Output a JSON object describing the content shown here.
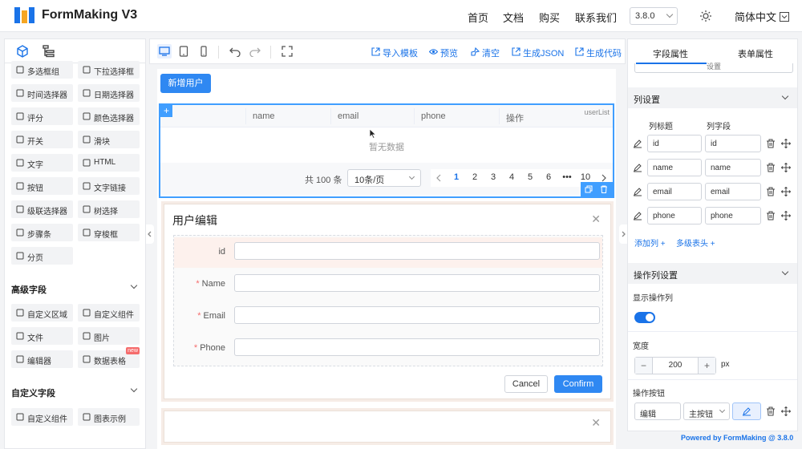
{
  "header": {
    "brand": "FormMaking V3",
    "nav": [
      "首页",
      "文档",
      "购买",
      "联系我们"
    ],
    "version": "3.8.0",
    "language": "简体中文"
  },
  "left_panel": {
    "basic_items": [
      {
        "label": "多选框组",
        "icon": "checkbox-icon"
      },
      {
        "label": "下拉选择框",
        "icon": "select-icon"
      },
      {
        "label": "时间选择器",
        "icon": "clock-icon"
      },
      {
        "label": "日期选择器",
        "icon": "calendar-icon"
      },
      {
        "label": "评分",
        "icon": "star-icon"
      },
      {
        "label": "颜色选择器",
        "icon": "palette-icon"
      },
      {
        "label": "开关",
        "icon": "switch-icon"
      },
      {
        "label": "滑块",
        "icon": "slider-icon"
      },
      {
        "label": "文字",
        "icon": "text-icon"
      },
      {
        "label": "HTML",
        "icon": "html-icon"
      },
      {
        "label": "按钮",
        "icon": "button-icon"
      },
      {
        "label": "文字链接",
        "icon": "link-icon"
      },
      {
        "label": "级联选择器",
        "icon": "cascader-icon"
      },
      {
        "label": "树选择",
        "icon": "tree-icon"
      },
      {
        "label": "步骤条",
        "icon": "steps-icon"
      },
      {
        "label": "穿梭框",
        "icon": "transfer-icon"
      },
      {
        "label": "分页",
        "icon": "pagination-icon"
      }
    ],
    "advanced_title": "高级字段",
    "advanced_items": [
      {
        "label": "自定义区域",
        "icon": "custom-area-icon"
      },
      {
        "label": "自定义组件",
        "icon": "custom-component-icon"
      },
      {
        "label": "文件",
        "icon": "file-icon"
      },
      {
        "label": "图片",
        "icon": "image-icon"
      },
      {
        "label": "编辑器",
        "icon": "editor-icon"
      },
      {
        "label": "数据表格",
        "icon": "table-icon"
      }
    ],
    "new_badge": "new",
    "custom_title": "自定义字段",
    "custom_items": [
      {
        "label": "自定义组件",
        "icon": "custom-component-icon"
      },
      {
        "label": "图表示例",
        "icon": "chart-icon"
      }
    ]
  },
  "toolbar": {
    "actions": [
      "导入模板",
      "预览",
      "清空",
      "生成JSON",
      "生成代码"
    ]
  },
  "canvas": {
    "add_user_button": "新增用户",
    "table": {
      "columns": [
        "name",
        "email",
        "phone",
        "操作"
      ],
      "label": "userList",
      "empty_text": "暂无数据",
      "total": "共 100 条",
      "page_size": "10条/页",
      "pages": [
        "1",
        "2",
        "3",
        "4",
        "5",
        "6",
        "•••",
        "10"
      ]
    },
    "dialog": {
      "title": "用户编辑",
      "fields": [
        {
          "label": "id",
          "required": ""
        },
        {
          "label": "Name",
          "required": "*"
        },
        {
          "label": "Email",
          "required": "*"
        },
        {
          "label": "Phone",
          "required": "*"
        }
      ],
      "cancel": "Cancel",
      "confirm": "Confirm"
    }
  },
  "right_panel": {
    "tabs": [
      "字段属性",
      "表单属性"
    ],
    "top_input": "设置",
    "column_section": "列设置",
    "col_title_header": "列标题",
    "col_field_header": "列字段",
    "columns": [
      {
        "title": "id",
        "field": "id"
      },
      {
        "title": "name",
        "field": "name"
      },
      {
        "title": "email",
        "field": "email"
      },
      {
        "title": "phone",
        "field": "phone"
      }
    ],
    "add_column": "添加列",
    "multi_header": "多级表头",
    "action_section": "操作列设置",
    "show_action_label": "显示操作列",
    "show_action": true,
    "width_label": "宽度",
    "width_value": "200",
    "width_unit": "px",
    "action_buttons_label": "操作按钮",
    "action_button_name": "编辑",
    "action_button_type": "主按钮"
  },
  "footer": "Powered by FormMaking @ 3.8.0",
  "colors": {
    "accent": "#1a73e8",
    "primary_button": "#2f88f2",
    "selected_border": "#409eff"
  }
}
